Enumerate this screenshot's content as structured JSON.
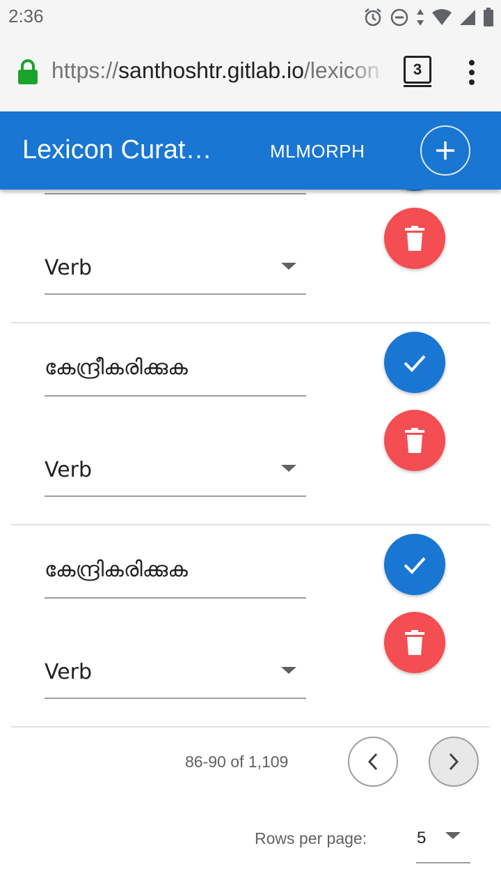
{
  "status_bar": {
    "time": "2:36",
    "icons": [
      "alarm-icon",
      "do-not-disturb-icon",
      "data-arrows-icon",
      "wifi-icon",
      "signal-icon",
      "battery-icon"
    ]
  },
  "browser": {
    "url_scheme": "https://",
    "url_host": "santhoshtr.gitlab.io",
    "url_path": "/lexicon",
    "tab_count": "3"
  },
  "app_bar": {
    "title": "Lexicon Curat…",
    "link_label": "MLMORPH",
    "add_icon": "plus-icon"
  },
  "entries": [
    {
      "word": "",
      "category": "Verb"
    },
    {
      "word": "കേന്ദ്രീകരിക്കുക",
      "category": "Verb"
    },
    {
      "word": "കേന്ദ്രികരിക്കുക",
      "category": "Verb"
    }
  ],
  "pagination": {
    "range": "86-90 of 1,109",
    "rows_per_page_label": "Rows per page:",
    "rows_per_page_value": "5"
  },
  "colors": {
    "primary": "#1976d2",
    "delete": "#f44d52",
    "status_bar_bg": "#f5f5f5",
    "lock": "#1aa32a"
  }
}
